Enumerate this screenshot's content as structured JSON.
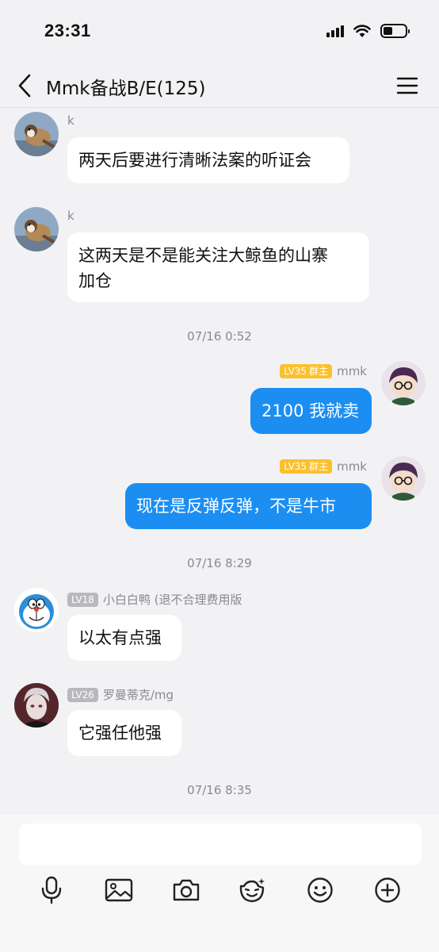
{
  "status_bar": {
    "time": "23:31"
  },
  "header": {
    "title": "Mmk备战B/E(125)"
  },
  "messages": [
    {
      "sender": "k",
      "text": "两天后要进行清晰法案的听证会"
    },
    {
      "sender": "k",
      "text": "这两天是不是能关注大鲸鱼的山寨加仓",
      "text_line1": "这两天是不是能关注大鲸鱼的山寨",
      "text_line2": "加仓"
    },
    {
      "timestamp": "07/16 0:52"
    },
    {
      "sender": "mmk",
      "level": "LV35",
      "role": "群主",
      "text": "2100 我就卖"
    },
    {
      "sender": "mmk",
      "level": "LV35",
      "role": "群主",
      "text": "现在是反弹反弹，不是牛市"
    },
    {
      "timestamp": "07/16 8:29"
    },
    {
      "sender": "小白白鸭 (退不合理费用版",
      "level": "LV18",
      "text": "以太有点强"
    },
    {
      "sender": "罗曼蒂克/mg",
      "level": "LV26",
      "text": "它强任他强"
    },
    {
      "timestamp": "07/16 8:35"
    }
  ],
  "toolbar": {
    "icons": [
      "microphone-icon",
      "image-icon",
      "camera-icon",
      "sticker-icon",
      "emoji-icon",
      "plus-icon"
    ]
  },
  "colors": {
    "outgoing_bubble": "#1c8ef2",
    "incoming_bubble": "#ffffff",
    "background": "#f2f2f4",
    "owner_badge": "#fbc02d",
    "member_badge": "#b9b9bd"
  }
}
